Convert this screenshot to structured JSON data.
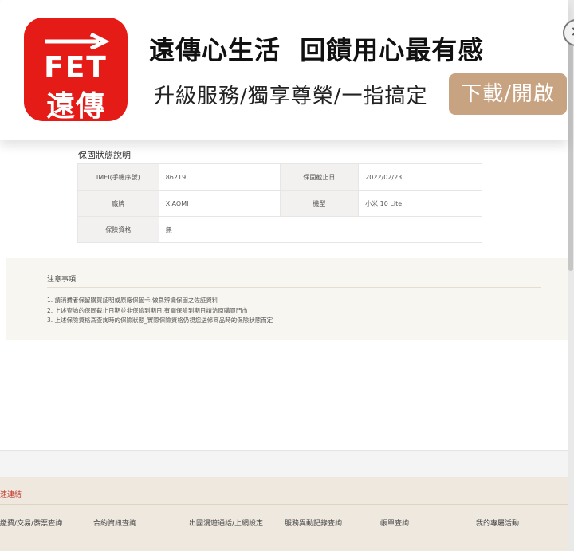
{
  "banner": {
    "logo_text": "FET",
    "logo_cn": "遠傳",
    "title": "遠傳心生活  回饋用心最有感",
    "subtitle": "升級服務/獨享尊榮/一指搞定",
    "action_label": "下載/開啟",
    "close_icon": "close-icon"
  },
  "warranty": {
    "title": "保固狀態說明",
    "rows": [
      [
        {
          "label": "IMEI(手機序號)",
          "value": "86219"
        },
        {
          "label": "保固截止日",
          "value": "2022/02/23"
        }
      ],
      [
        {
          "label": "廠牌",
          "value": "XIAOMI"
        },
        {
          "label": "機型",
          "value": "小米 10 Lite"
        }
      ],
      [
        {
          "label": "保險資格",
          "value": "無"
        }
      ]
    ]
  },
  "notes": {
    "title": "注意事項",
    "items": [
      "1. 請消費者保留購買証明或原廠保固卡,做爲辨識保固之佐証資料",
      "2. 上述查詢的保固截止日期並非保險到期日,有關保險到期日請洽原購買門市",
      "3. 上述保險資格爲查詢時的保險狀態_實際保險資格仍視您送修商品時的保險狀態而定"
    ]
  },
  "footer": {
    "quick_title": "速連結",
    "links": [
      "繳費/交易/發票查詢",
      "合約資訊查詢",
      "出國漫遊通話/上網設定",
      "服務異動記錄查詢",
      "帳單查詢",
      "我的專屬活動"
    ]
  },
  "colors": {
    "brand_red": "#e51b17",
    "action_button": "#c8a382",
    "table_label_bg": "#f3f1ef",
    "notes_bg": "#f8f6f1",
    "footer_bg": "#eee8df"
  }
}
